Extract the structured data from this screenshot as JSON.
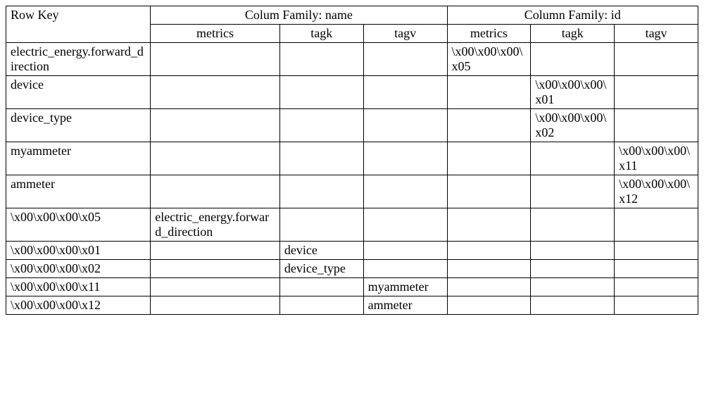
{
  "headers": {
    "row_key": "Row Key",
    "cf_name": "Colum Family: name",
    "cf_id": "Column Family: id",
    "sub": {
      "metrics": "metrics",
      "tagk": "tagk",
      "tagv": "tagv"
    }
  },
  "rows": [
    {
      "key": "electric_energy.forward_direction",
      "name_metrics": "",
      "name_tagk": "",
      "name_tagv": "",
      "id_metrics": "\\x00\\x00\\x00\\x05",
      "id_tagk": "",
      "id_tagv": ""
    },
    {
      "key": "device",
      "name_metrics": "",
      "name_tagk": "",
      "name_tagv": "",
      "id_metrics": "",
      "id_tagk": "\\x00\\x00\\x00\\x01",
      "id_tagv": ""
    },
    {
      "key": "device_type",
      "name_metrics": "",
      "name_tagk": "",
      "name_tagv": "",
      "id_metrics": "",
      "id_tagk": "\\x00\\x00\\x00\\x02",
      "id_tagv": ""
    },
    {
      "key": "myammeter",
      "name_metrics": "",
      "name_tagk": "",
      "name_tagv": "",
      "id_metrics": "",
      "id_tagk": "",
      "id_tagv": "\\x00\\x00\\x00\\x11"
    },
    {
      "key": "ammeter",
      "name_metrics": "",
      "name_tagk": "",
      "name_tagv": "",
      "id_metrics": "",
      "id_tagk": "",
      "id_tagv": "\\x00\\x00\\x00\\x12"
    },
    {
      "key": "\\x00\\x00\\x00\\x05",
      "name_metrics": "electric_energy.forward_direction",
      "name_tagk": "",
      "name_tagv": "",
      "id_metrics": "",
      "id_tagk": "",
      "id_tagv": ""
    },
    {
      "key": "\\x00\\x00\\x00\\x01",
      "name_metrics": "",
      "name_tagk": "device",
      "name_tagv": "",
      "id_metrics": "",
      "id_tagk": "",
      "id_tagv": ""
    },
    {
      "key": "\\x00\\x00\\x00\\x02",
      "name_metrics": "",
      "name_tagk": "device_type",
      "name_tagv": "",
      "id_metrics": "",
      "id_tagk": "",
      "id_tagv": ""
    },
    {
      "key": "\\x00\\x00\\x00\\x11",
      "name_metrics": "",
      "name_tagk": "",
      "name_tagv": "myammeter",
      "id_metrics": "",
      "id_tagk": "",
      "id_tagv": ""
    },
    {
      "key": "\\x00\\x00\\x00\\x12",
      "name_metrics": "",
      "name_tagk": "",
      "name_tagv": "ammeter",
      "id_metrics": "",
      "id_tagk": "",
      "id_tagv": ""
    }
  ]
}
